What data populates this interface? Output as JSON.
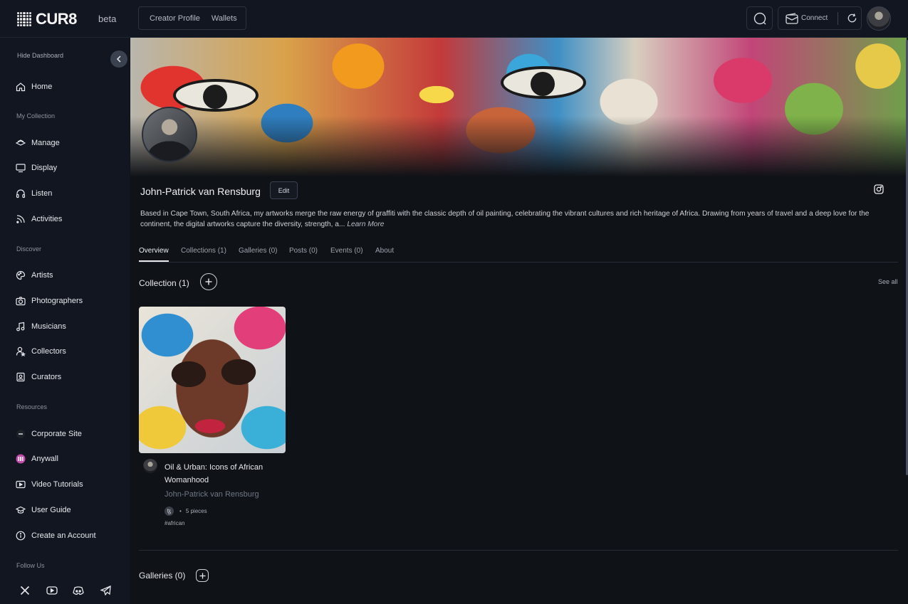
{
  "brand": {
    "logo_text": "CUR8",
    "badge": "beta"
  },
  "topnav": {
    "items": [
      "Creator Profile",
      "Wallets"
    ]
  },
  "header": {
    "connect_label": "Connect"
  },
  "sidebar": {
    "hide_label": "Hide Dashboard",
    "home": "Home",
    "sections": {
      "my_collection": "My Collection",
      "discover": "Discover",
      "resources": "Resources",
      "follow": "Follow Us"
    },
    "my_collection_items": [
      "Manage",
      "Display",
      "Listen",
      "Activities"
    ],
    "discover_items": [
      "Artists",
      "Photographers",
      "Musicians",
      "Collectors",
      "Curators"
    ],
    "resource_items": [
      "Corporate Site",
      "Anywall",
      "Video Tutorials",
      "User Guide",
      "Create an Account"
    ]
  },
  "profile": {
    "name": "John-Patrick van Rensburg",
    "edit_label": "Edit",
    "bio": "Based in Cape Town, South Africa, my artworks merge the raw energy of graffiti with the classic depth of oil painting, celebrating the vibrant cultures and rich heritage of Africa. Drawing from years of travel and a deep love for the continent, the digital artworks capture the diversity, strength, a...",
    "learn_more": "Learn More"
  },
  "tabs": [
    "Overview",
    "Collections (1)",
    "Galleries (0)",
    "Posts (0)",
    "Events (0)",
    "About"
  ],
  "collection": {
    "title": "Collection (1)",
    "see_all": "See all",
    "card": {
      "title": "Oil & Urban: Icons of African Womanhood",
      "artist": "John-Patrick van Rensburg",
      "chain_symbol": "ꜩ",
      "pieces": "5 pieces",
      "tag": "#african"
    }
  },
  "galleries": {
    "title": "Galleries (0)"
  },
  "colors": {
    "bg": "#101318",
    "sidebar": "#121621",
    "accent_link": "#6f7785"
  },
  "icons": [
    "search-icon",
    "wallet-icon",
    "refresh-icon",
    "chevron-left-icon",
    "instagram-icon",
    "plus-icon",
    "x-icon",
    "youtube-icon",
    "discord-icon",
    "telegram-icon"
  ]
}
